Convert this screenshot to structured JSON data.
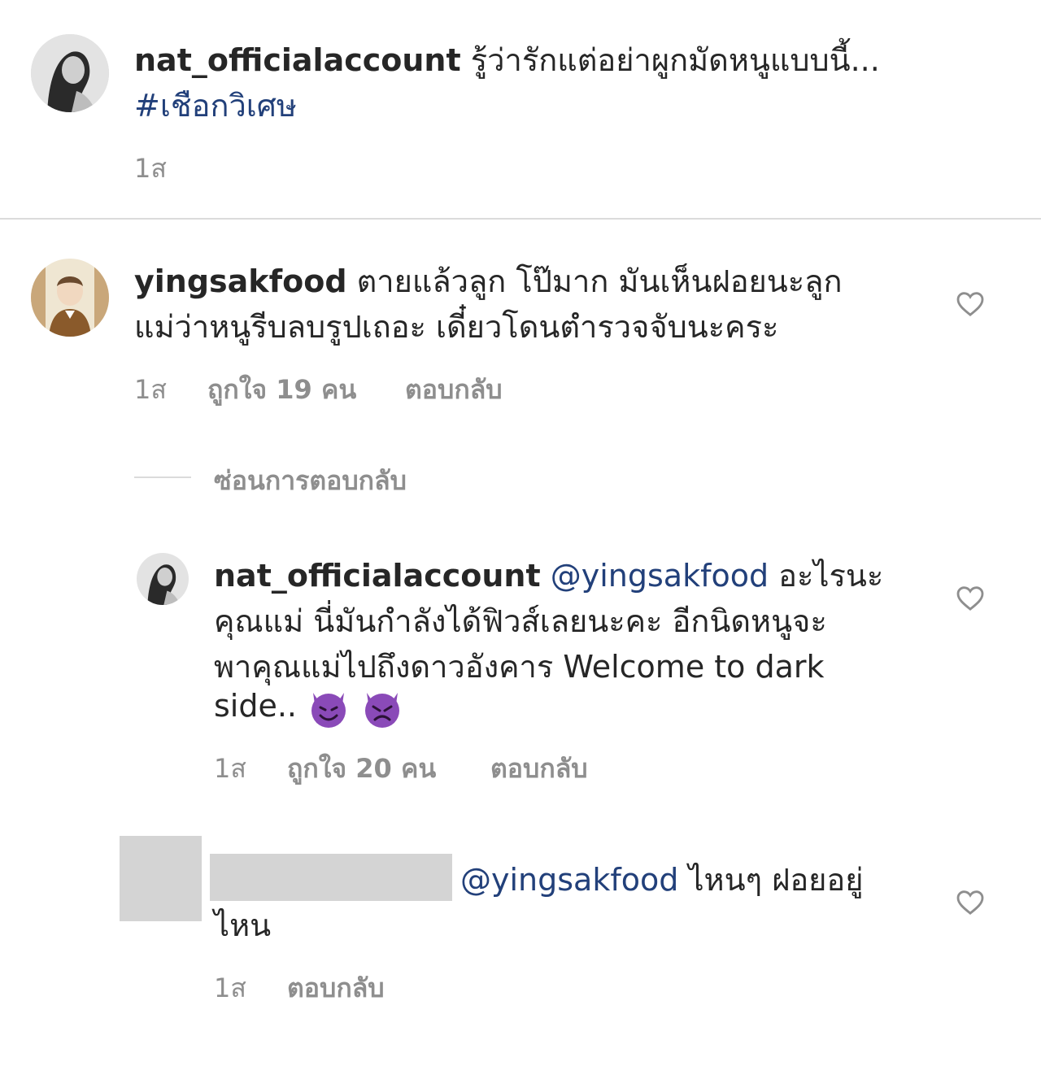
{
  "post": {
    "username": "nat_officialaccount",
    "caption": "รู้ว่ารักแต่อย่าผูกมัดหนูแบบนี้...",
    "hashtag": "#เชือกวิเศษ",
    "time": "1ส"
  },
  "comments": [
    {
      "username": "yingsakfood",
      "text_line1": "ตายแล้วลูก โป๊มาก มันเห็นฝอยนะลูก",
      "text_line2": "แม่ว่าหนูรีบลบรูปเถอะ เดี๋ยวโดนตำรวจจับนะคระ",
      "time": "1ส",
      "likes": "ถูกใจ 19 คน",
      "reply_label": "ตอบกลับ"
    }
  ],
  "hide_replies": "ซ่อนการตอบกลับ",
  "reply": {
    "username": "nat_officialaccount",
    "mention": "@yingsakfood",
    "line1_tail": "อะไรนะ",
    "line2": "คุณแม่ นี่มันกำลังได้ฟิวส์เลยนะคะ อีกนิดหนูจะ",
    "line3": "พาคุณแม่ไปถึงดาวอังคาร Welcome to dark",
    "line4": "side..",
    "emoji1": "😈",
    "emoji2": "👿",
    "time": "1ส",
    "likes": "ถูกใจ 20 คน",
    "reply_label": "ตอบกลับ"
  },
  "third": {
    "mention": "@yingsakfood",
    "line1_tail": "ไหนๆ ฝอยอยู่",
    "line2": "ไหน",
    "time": "1ส",
    "reply_label": "ตอบกลับ"
  },
  "icons": {
    "heart": "heart-outline-icon"
  },
  "colors": {
    "mention": "#22407a",
    "meta": "#8e8e8e",
    "censor": "#d4d4d4"
  }
}
